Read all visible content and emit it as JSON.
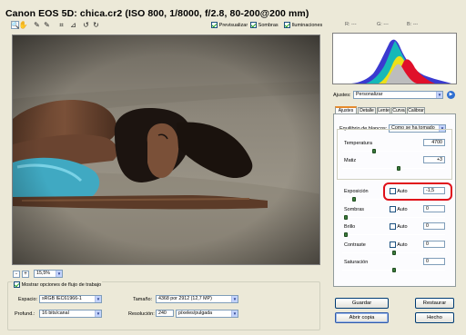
{
  "title": "Canon EOS 5D:  chica.cr2  (ISO 800, 1/8000, f/2.8, 80-200@200 mm)",
  "toolbar": {
    "tools": [
      {
        "name": "zoom-tool-icon",
        "glyph": "🔍"
      },
      {
        "name": "hand-tool-icon",
        "glyph": "✋"
      },
      {
        "name": "white-balance-tool-icon",
        "glyph": "✎"
      },
      {
        "name": "color-sampler-tool-icon",
        "glyph": "✎"
      },
      {
        "name": "crop-tool-icon",
        "glyph": "⌗"
      },
      {
        "name": "straighten-tool-icon",
        "glyph": "⊿"
      },
      {
        "name": "rotate-left-icon",
        "glyph": "↺"
      },
      {
        "name": "rotate-right-icon",
        "glyph": "↻"
      }
    ],
    "preview_label": "Previsualizar",
    "shadows_label": "Sombras",
    "highlights_label": "Iluminaciones"
  },
  "readout": {
    "r": "R: ---",
    "g": "G: ---",
    "b": "B: ---"
  },
  "zoom": {
    "minus": "-",
    "plus": "+",
    "value": "15,5%"
  },
  "settings": {
    "label": "Ajustes:",
    "value": "Personalizar",
    "tabs": [
      "Ajustes",
      "Detalle",
      "Lente",
      "Curva",
      "Calibrar"
    ],
    "white_balance_label": "Equilibrio de blancos:",
    "white_balance_value": "Como se ha tomado",
    "temperature_label": "Temperatura",
    "temperature_value": "4700",
    "tint_label": "Matiz",
    "tint_value": "+3",
    "auto_label": "Auto",
    "exposure_label": "Exposición",
    "exposure_value": "-1,5",
    "shadows_label": "Sombras",
    "shadows_value": "0",
    "brightness_label": "Brillo",
    "brightness_value": "0",
    "contrast_label": "Contraste",
    "contrast_value": "0",
    "saturation_label": "Saturación",
    "saturation_value": "0"
  },
  "slider_levels": {
    "temperature": 0.3,
    "tint": 0.55,
    "exposure": 0.1,
    "shadows": 0.02,
    "brightness": 0.02,
    "contrast": 0.5,
    "saturation": 0.5
  },
  "workflow": {
    "show_label": "Mostrar opciones de flujo de trabajo",
    "space_label": "Espacio:",
    "space_value": "sRGB IEC61966-1",
    "depth_label": "Profund.:",
    "depth_value": "16 bits/canal",
    "size_label": "Tamaño:",
    "size_value": "4368 por 2912 (12,7 MP)",
    "resolution_label": "Resolución:",
    "resolution_value": "240",
    "resolution_unit": "píxeles/pulgada"
  },
  "buttons": {
    "save": "Guardar",
    "open_copy": "Abrir copia",
    "reset": "Restaurar",
    "done": "Hecho"
  },
  "colors": {
    "highlight_ring": "#e0101a",
    "accent_tab": "#e68b2c",
    "window_bg": "#ece9d8"
  }
}
